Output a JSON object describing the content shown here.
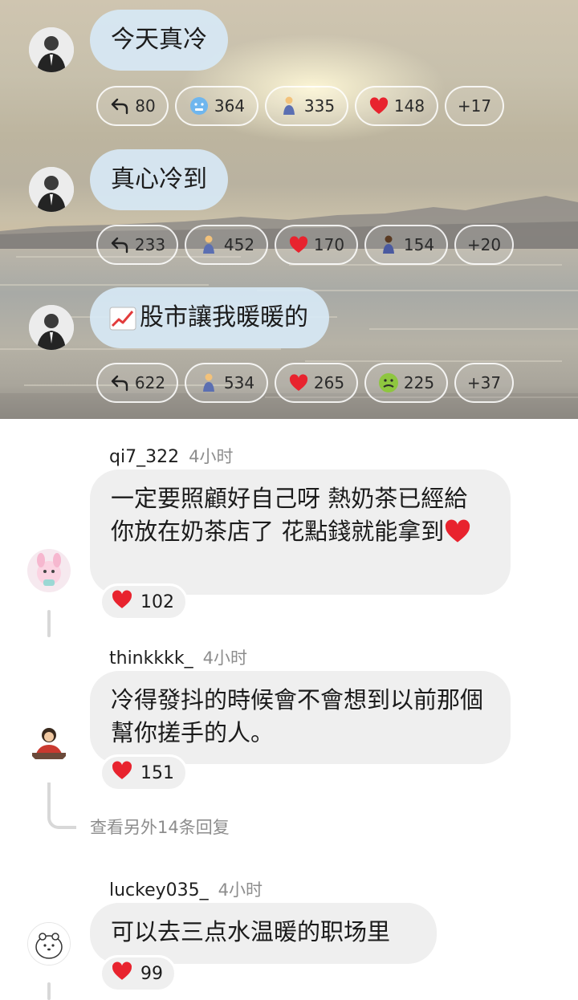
{
  "colors": {
    "heart": "#e8232e",
    "bubble_blue": "#d7e8f5",
    "comment_bg": "#efefef",
    "muted": "#8d8d8d"
  },
  "messages": [
    {
      "text": "今天真冷",
      "reactions": [
        {
          "icon": "reply-icon",
          "count": "80"
        },
        {
          "icon": "cold-face-icon",
          "count": "364"
        },
        {
          "icon": "person-sweat-icon",
          "count": "335"
        },
        {
          "icon": "heart-icon",
          "count": "148"
        },
        {
          "label": "+17"
        }
      ]
    },
    {
      "text": "真心冷到",
      "reactions": [
        {
          "icon": "reply-icon",
          "count": "233"
        },
        {
          "icon": "person-sweat-icon",
          "count": "452"
        },
        {
          "icon": "heart-icon",
          "count": "170"
        },
        {
          "icon": "person-dark-icon",
          "count": "154"
        },
        {
          "label": "+20"
        }
      ]
    },
    {
      "emoji": "chart-increasing-icon",
      "text": "股市讓我暖暖的",
      "reactions": [
        {
          "icon": "reply-icon",
          "count": "622"
        },
        {
          "icon": "person-sweat-icon",
          "count": "534"
        },
        {
          "icon": "heart-icon",
          "count": "265"
        },
        {
          "icon": "nauseated-face-icon",
          "count": "225"
        },
        {
          "label": "+37"
        }
      ]
    }
  ],
  "comments": [
    {
      "username": "qi7_322",
      "time": "4小时",
      "text": "一定要照顧好自己呀 熱奶茶已經給你放在奶茶店了 花點錢就能拿到",
      "likes": "102"
    },
    {
      "username": "thinkkkk_",
      "time": "4小时",
      "text": "冷得發抖的時候會不會想到以前那個幫你搓手的人。",
      "likes": "151"
    },
    {
      "username": "luckey035_",
      "time": "4小时",
      "text": "可以去三点水温暖的职场里",
      "likes": "99"
    }
  ],
  "more_replies": "查看另外14条回复"
}
